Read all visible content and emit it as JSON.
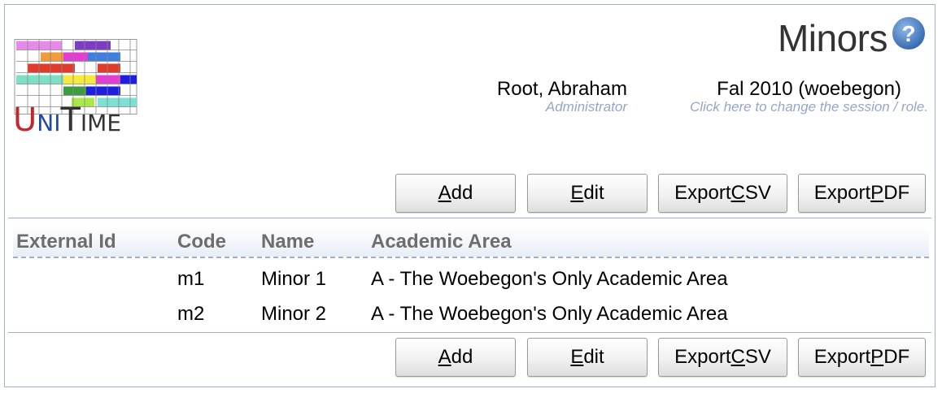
{
  "app": {
    "logo_text": "UniTime"
  },
  "header": {
    "title": "Minors",
    "help_icon": "question-circle-icon",
    "user_name": "Root, Abraham",
    "user_role": "Administrator",
    "session_name": "Fal 2010 (woebegon)",
    "session_hint": "Click here to change the session / role."
  },
  "toolbar": {
    "add": {
      "pre": "",
      "key": "A",
      "post": "dd"
    },
    "edit": {
      "pre": "",
      "key": "E",
      "post": "dit"
    },
    "export_csv": {
      "pre": "Export ",
      "key": "C",
      "post": "SV"
    },
    "export_pdf": {
      "pre": "Export ",
      "key": "P",
      "post": "DF"
    }
  },
  "table": {
    "columns": [
      "External Id",
      "Code",
      "Name",
      "Academic Area"
    ],
    "rows": [
      {
        "external_id": "",
        "code": "m1",
        "name": "Minor 1",
        "academic_area": "A - The Woebegon's Only Academic Area"
      },
      {
        "external_id": "",
        "code": "m2",
        "name": "Minor 2",
        "academic_area": "A - The Woebegon's Only Academic Area"
      }
    ]
  },
  "colors": {
    "border": "#9cb0ce",
    "header_text": "#6d6d6d",
    "hint_text": "#97a6c8",
    "help_icon": "#4a7fc1"
  }
}
